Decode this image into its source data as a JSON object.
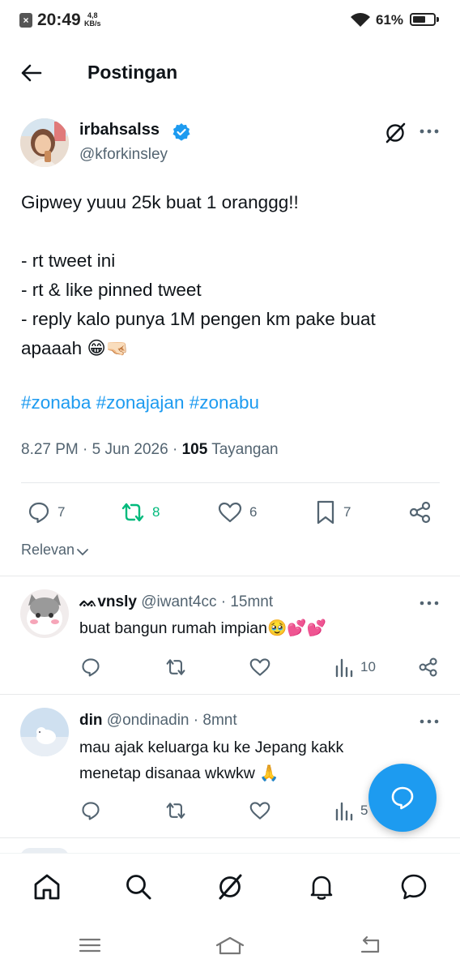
{
  "status_bar": {
    "time": "20:49",
    "net_speed_value": "4,8",
    "net_speed_unit": "KB/s",
    "battery_pct": "61%",
    "battery_level": 0.61
  },
  "header": {
    "title": "Postingan"
  },
  "tweet": {
    "author_name": "irbahsalss",
    "author_handle": "@kforkinsley",
    "line1": "Gipwey yuuu 25k buat 1 oranggg!!",
    "line2": "- rt tweet ini",
    "line3": "- rt & like pinned tweet",
    "line4": "- reply kalo punya 1M pengen km pake buat",
    "line5": "apaaah 😁🤜🏻",
    "tag1": "#zonaba",
    "tag2": "#zonajajan",
    "tag3": "#zonabu",
    "time": "8.27 PM",
    "date": "5 Jun 2026",
    "views_count": "105",
    "views_label": "Tayangan",
    "replies": "7",
    "retweets": "8",
    "likes": "6",
    "bookmarks": "7"
  },
  "sort": {
    "label": "Relevan"
  },
  "replies": [
    {
      "name": "ᨐvnsly",
      "handle": "@iwant4cc",
      "time": "15mnt",
      "text": "buat bangun rumah impian🥹💕💕",
      "views": "10"
    },
    {
      "name": "din",
      "handle": "@ondinadin",
      "time": "8mnt",
      "text_line1": "mau ajak keluarga ku ke Jepang kakk",
      "text_line2": "menetap disanaa wkwkw 🙏",
      "views": "5"
    }
  ],
  "colors": {
    "accent": "#1d9bf0",
    "retweet_green": "#00ba7c",
    "text_secondary": "#536471"
  },
  "icons": [
    "back-arrow-icon",
    "verified-icon",
    "grok-icon",
    "more-icon",
    "reply-icon",
    "retweet-icon",
    "like-icon",
    "bookmark-icon",
    "share-icon",
    "views-icon",
    "compose-reply-icon",
    "home-icon",
    "search-icon",
    "notifications-icon",
    "messages-icon"
  ]
}
